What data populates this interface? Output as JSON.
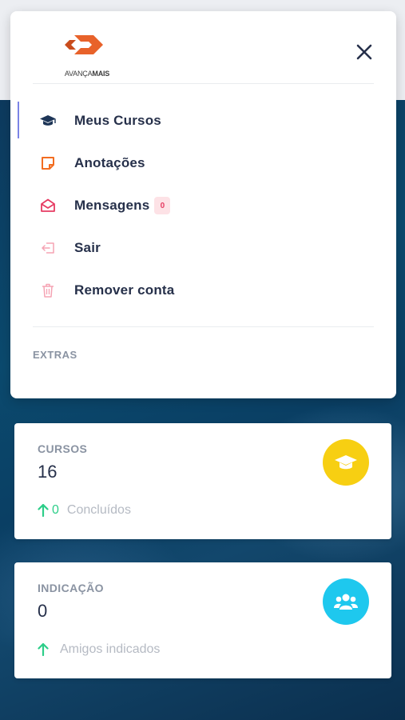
{
  "brand": {
    "logo_text_regular": "AVANÇA",
    "logo_text_bold": "MAIS",
    "logo_color": "#e8622a"
  },
  "menu": {
    "items": [
      {
        "label": "Meus Cursos",
        "icon": "graduation-cap-icon",
        "color": "#1d3557"
      },
      {
        "label": "Anotações",
        "icon": "note-icon",
        "color": "#f26d21"
      },
      {
        "label": "Mensagens",
        "icon": "envelope-open-icon",
        "color": "#e63c63",
        "badge": "0"
      },
      {
        "label": "Sair",
        "icon": "logout-icon",
        "color": "#f5a3b3"
      },
      {
        "label": "Remover conta",
        "icon": "trash-icon",
        "color": "#f5a3b3"
      }
    ],
    "section_label": "EXTRAS"
  },
  "cards": [
    {
      "title": "CURSOS",
      "value": "16",
      "foot_number": "0",
      "foot_label": "Concluídos",
      "icon": "graduation-cap-icon",
      "icon_bg": "#f7cf12"
    },
    {
      "title": "INDICAÇÃO",
      "value": "0",
      "foot_number": "",
      "foot_label": "Amigos indicados",
      "icon": "users-icon",
      "icon_bg": "#1ec8ee"
    }
  ],
  "colors": {
    "accent_green": "#2dce89",
    "active_indicator": "#7b84e6"
  }
}
